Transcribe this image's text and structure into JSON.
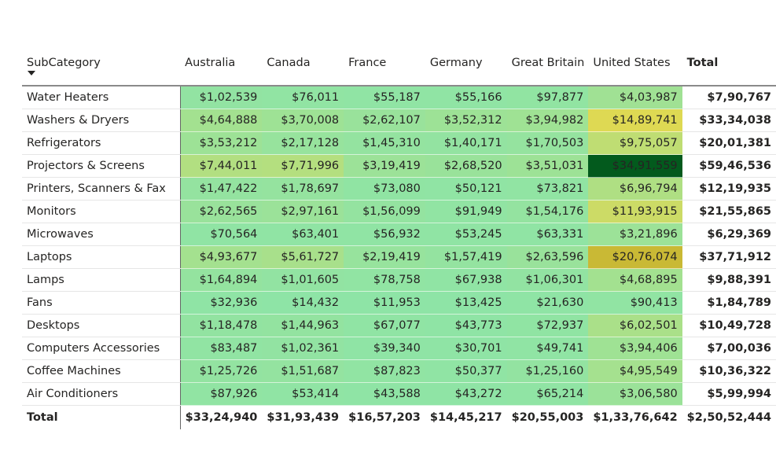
{
  "chart_data": {
    "type": "heatmap",
    "title": "",
    "row_header": "SubCategory",
    "sort": "descending",
    "columns": [
      "Australia",
      "Canada",
      "France",
      "Germany",
      "Great Britain",
      "United States"
    ],
    "total_label": "Total",
    "rows": [
      {
        "name": "Water Heaters",
        "values": [
          "$1,02,539",
          "$76,011",
          "$55,187",
          "$55,166",
          "$97,877",
          "$4,03,987"
        ],
        "raw": [
          102539,
          76011,
          55187,
          55166,
          97877,
          403987
        ],
        "total": "$7,90,767"
      },
      {
        "name": "Washers & Dryers",
        "values": [
          "$4,64,888",
          "$3,70,008",
          "$2,62,107",
          "$3,52,312",
          "$3,94,982",
          "$14,89,741"
        ],
        "raw": [
          464888,
          370008,
          262107,
          352312,
          394982,
          1489741
        ],
        "total": "$33,34,038"
      },
      {
        "name": "Refrigerators",
        "values": [
          "$3,53,212",
          "$2,17,128",
          "$1,45,310",
          "$1,40,171",
          "$1,70,503",
          "$9,75,057"
        ],
        "raw": [
          353212,
          217128,
          145310,
          140171,
          170503,
          975057
        ],
        "total": "$20,01,381"
      },
      {
        "name": "Projectors & Screens",
        "values": [
          "$7,44,011",
          "$7,71,996",
          "$3,19,419",
          "$2,68,520",
          "$3,51,031",
          "$34,91,559"
        ],
        "raw": [
          744011,
          771996,
          319419,
          268520,
          351031,
          3491559
        ],
        "total": "$59,46,536"
      },
      {
        "name": "Printers, Scanners & Fax",
        "values": [
          "$1,47,422",
          "$1,78,697",
          "$73,080",
          "$50,121",
          "$73,821",
          "$6,96,794"
        ],
        "raw": [
          147422,
          178697,
          73080,
          50121,
          73821,
          696794
        ],
        "total": "$12,19,935"
      },
      {
        "name": "Monitors",
        "values": [
          "$2,62,565",
          "$2,97,161",
          "$1,56,099",
          "$91,949",
          "$1,54,176",
          "$11,93,915"
        ],
        "raw": [
          262565,
          297161,
          156099,
          91949,
          154176,
          1193915
        ],
        "total": "$21,55,865"
      },
      {
        "name": "Microwaves",
        "values": [
          "$70,564",
          "$63,401",
          "$56,932",
          "$53,245",
          "$63,331",
          "$3,21,896"
        ],
        "raw": [
          70564,
          63401,
          56932,
          53245,
          63331,
          321896
        ],
        "total": "$6,29,369"
      },
      {
        "name": "Laptops",
        "values": [
          "$4,93,677",
          "$5,61,727",
          "$2,19,419",
          "$1,57,419",
          "$2,63,596",
          "$20,76,074"
        ],
        "raw": [
          493677,
          561727,
          219419,
          157419,
          263596,
          2076074
        ],
        "total": "$37,71,912"
      },
      {
        "name": "Lamps",
        "values": [
          "$1,64,894",
          "$1,01,605",
          "$78,758",
          "$67,938",
          "$1,06,301",
          "$4,68,895"
        ],
        "raw": [
          164894,
          101605,
          78758,
          67938,
          106301,
          468895
        ],
        "total": "$9,88,391"
      },
      {
        "name": "Fans",
        "values": [
          "$32,936",
          "$14,432",
          "$11,953",
          "$13,425",
          "$21,630",
          "$90,413"
        ],
        "raw": [
          32936,
          14432,
          11953,
          13425,
          21630,
          90413
        ],
        "total": "$1,84,789"
      },
      {
        "name": "Desktops",
        "values": [
          "$1,18,478",
          "$1,44,963",
          "$67,077",
          "$43,773",
          "$72,937",
          "$6,02,501"
        ],
        "raw": [
          118478,
          144963,
          67077,
          43773,
          72937,
          602501
        ],
        "total": "$10,49,728"
      },
      {
        "name": "Computers Accessories",
        "values": [
          "$83,487",
          "$1,02,361",
          "$39,340",
          "$30,701",
          "$49,741",
          "$3,94,406"
        ],
        "raw": [
          83487,
          102361,
          39340,
          30701,
          49741,
          394406
        ],
        "total": "$7,00,036"
      },
      {
        "name": "Coffee Machines",
        "values": [
          "$1,25,726",
          "$1,51,687",
          "$87,823",
          "$50,377",
          "$1,25,160",
          "$4,95,549"
        ],
        "raw": [
          125726,
          151687,
          87823,
          50377,
          125160,
          495549
        ],
        "total": "$10,36,322"
      },
      {
        "name": "Air Conditioners",
        "values": [
          "$87,926",
          "$53,414",
          "$43,588",
          "$43,272",
          "$65,214",
          "$3,06,580"
        ],
        "raw": [
          87926,
          53414,
          43588,
          43272,
          65214,
          306580
        ],
        "total": "$5,99,994"
      }
    ],
    "column_totals": [
      "$33,24,940",
      "$31,93,439",
      "$16,57,203",
      "$14,45,217",
      "$20,55,003",
      "$1,33,76,642"
    ],
    "grand_total": "$2,50,52,444",
    "color_scale": {
      "low": "#8ee4a6",
      "mid": "#e3d84e",
      "high": "#c5b431",
      "max": "#035a1d"
    }
  }
}
